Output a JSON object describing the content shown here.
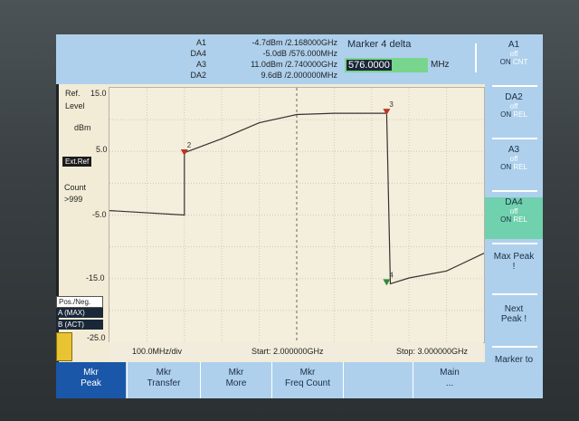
{
  "markers": [
    {
      "label": "A1",
      "value": "-4.7dBm /2.168000GHz"
    },
    {
      "label": "DA4",
      "value": "-5.0dB /576.000MHz"
    },
    {
      "label": "A3",
      "value": "11.0dBm /2.740000GHz"
    },
    {
      "label": "DA2",
      "value": "9.6dB /2.000000MHz"
    }
  ],
  "entry": {
    "title": "Marker 4 delta",
    "value": "576.0000",
    "unit": "MHz"
  },
  "left_panel": {
    "ref_label": "Ref.",
    "level_label": "Level",
    "unit": "dBm",
    "ext_ref": "Ext.Ref",
    "count_label": "Count",
    "count_value": ">999",
    "ticks": [
      "15.0",
      "5.0",
      "-5.0",
      "-15.0",
      "-25.0"
    ],
    "pos_neg": "Pos./Neg.",
    "trace_a": "A (MAX)",
    "trace_b": "B (ACT)"
  },
  "bottom_info": {
    "div": "100.0MHz/div",
    "start": "Start: 2.000000GHz",
    "stop": "Stop: 3.000000GHz"
  },
  "side_buttons": [
    {
      "title": "A1",
      "state": "off",
      "on": "ON",
      "mode": "CNT"
    },
    {
      "title": "DA2",
      "state": "off",
      "on": "ON",
      "mode": "REL"
    },
    {
      "title": "A3",
      "state": "off",
      "on": "ON",
      "mode": "REL"
    },
    {
      "title": "DA4",
      "state": "off",
      "on": "ON",
      "mode": "REL"
    },
    {
      "title": "Max Peak !"
    },
    {
      "title": "Next Peak !"
    },
    {
      "title": "Marker to Center !"
    }
  ],
  "softkeys": [
    {
      "line1": "Mkr",
      "line2": "Peak"
    },
    {
      "line1": "Mkr",
      "line2": "Transfer"
    },
    {
      "line1": "Mkr",
      "line2": "More"
    },
    {
      "line1": "Mkr",
      "line2": "Freq Count"
    },
    {
      "line1": "",
      "line2": ""
    },
    {
      "line1": "Main",
      "line2": "..."
    }
  ],
  "marker_labels": [
    "2",
    "3",
    "4"
  ],
  "chart_data": {
    "type": "line",
    "x_unit": "GHz",
    "y_unit": "dBm",
    "xlim": [
      2.0,
      3.0
    ],
    "ylim": [
      -25,
      15
    ],
    "x_division": "100.0MHz/div",
    "grid": true,
    "series": [
      {
        "x": [
          2.0,
          2.2,
          2.2,
          2.3,
          2.4,
          2.5,
          2.6,
          2.74,
          2.75,
          2.8,
          2.9,
          3.0
        ],
        "y": [
          -4.3,
          -5.0,
          4.8,
          7.0,
          9.5,
          10.8,
          11.0,
          11.0,
          -15.8,
          -14.9,
          -13.8,
          -11.0
        ]
      }
    ],
    "markers": [
      {
        "label": "2",
        "x": 2.2,
        "y": 4.6
      },
      {
        "label": "3",
        "x": 2.74,
        "y": 11.0
      },
      {
        "label": "4",
        "x": 2.74,
        "y": -15.8
      }
    ]
  }
}
